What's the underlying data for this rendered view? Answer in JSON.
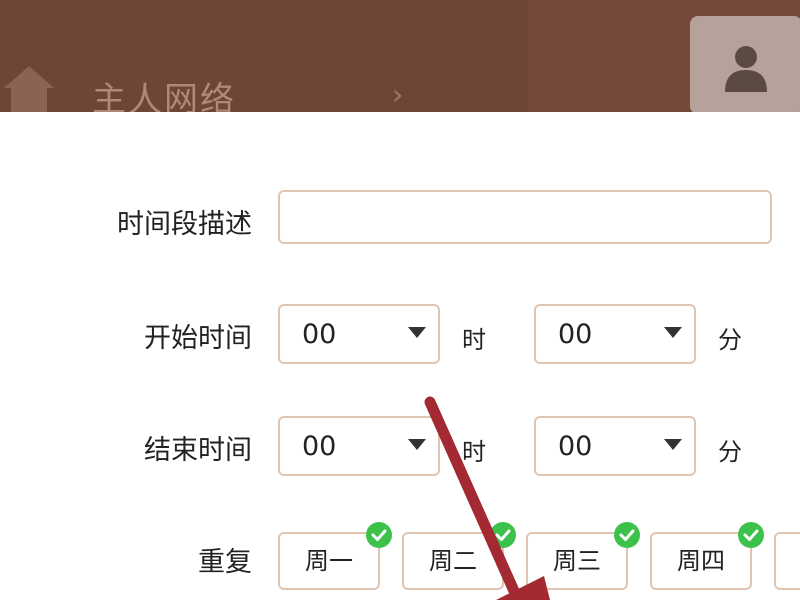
{
  "header": {
    "title": "主人网络",
    "chevron": "›"
  },
  "form": {
    "description": {
      "label": "时间段描述",
      "value": "",
      "placeholder": ""
    },
    "start": {
      "label": "开始时间",
      "hour": "00",
      "hour_unit": "时",
      "minute": "00",
      "minute_unit": "分"
    },
    "end": {
      "label": "结束时间",
      "hour": "00",
      "hour_unit": "时",
      "minute": "00",
      "minute_unit": "分"
    },
    "repeat": {
      "label": "重复",
      "days": [
        {
          "label": "周一",
          "checked": true
        },
        {
          "label": "周二",
          "checked": true
        },
        {
          "label": "周三",
          "checked": true
        },
        {
          "label": "周四",
          "checked": true
        }
      ]
    }
  },
  "colors": {
    "header_bg": "#6d4638",
    "border": "#e0c6b2",
    "check": "#3cc24a",
    "annotation_arrow": "#a32a32"
  }
}
